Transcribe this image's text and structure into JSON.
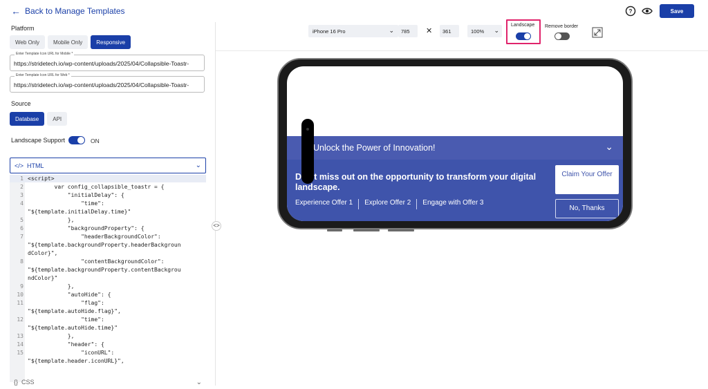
{
  "header": {
    "back_label": "Back to Manage Templates",
    "save_label": "Save"
  },
  "left": {
    "platform_label": "Platform",
    "platform_options": [
      "Web Only",
      "Mobile Only",
      "Responsive"
    ],
    "mobile_icon_legend": "Enter Template Icon URL for Mobile *",
    "mobile_icon_value": "https://stridetech.io/wp-content/uploads/2025/04/Collapsible-Toastr-",
    "web_icon_legend": "Enter Template Icon URL for Web *",
    "web_icon_value": "https://stridetech.io/wp-content/uploads/2025/04/Collapsible-Toastr-",
    "source_label": "Source",
    "source_options": [
      "Database",
      "API"
    ],
    "landscape_support_label": "Landscape Support",
    "landscape_support_state": "ON",
    "html_select_label": "HTML",
    "css_select_label": "CSS",
    "code_lines": [
      {
        "num": "1",
        "text": "<script>"
      },
      {
        "num": "2",
        "text": "        var config_collapsible_toastr = {"
      },
      {
        "num": "3",
        "text": "            \"initialDelay\": {"
      },
      {
        "num": "4",
        "text": "                \"time\":"
      },
      {
        "num": "",
        "text": "\"${template.initialDelay.time}\""
      },
      {
        "num": "5",
        "text": "            },"
      },
      {
        "num": "6",
        "text": "            \"backgroundProperty\": {"
      },
      {
        "num": "7",
        "text": "                \"headerBackgroundColor\":"
      },
      {
        "num": "",
        "text": "\"${template.backgroundProperty.headerBackgroun"
      },
      {
        "num": "",
        "text": "dColor}\","
      },
      {
        "num": "8",
        "text": "                \"contentBackgroundColor\":"
      },
      {
        "num": "",
        "text": "\"${template.backgroundProperty.contentBackgrou"
      },
      {
        "num": "",
        "text": "ndColor}\""
      },
      {
        "num": "9",
        "text": "            },"
      },
      {
        "num": "10",
        "text": "            \"autoHide\": {"
      },
      {
        "num": "11",
        "text": "                \"flag\":"
      },
      {
        "num": "",
        "text": "\"${template.autoHide.flag}\","
      },
      {
        "num": "12",
        "text": "                \"time\":"
      },
      {
        "num": "",
        "text": "\"${template.autoHide.time}\""
      },
      {
        "num": "13",
        "text": "            },"
      },
      {
        "num": "14",
        "text": "            \"header\": {"
      },
      {
        "num": "15",
        "text": "                \"iconURL\":"
      },
      {
        "num": "",
        "text": "\"${template.header.iconURL}\","
      }
    ]
  },
  "toolbar": {
    "device": "iPhone 16 Pro",
    "width": "785",
    "times": "✕",
    "height": "361",
    "zoom": "100%",
    "landscape_label": "Landscape",
    "remove_border_label": "Remove border"
  },
  "preview": {
    "header_title": "Unlock the Power of Innovation!",
    "message": "Don't miss out on the opportunity to transform your digital landscape.",
    "links": [
      "Experience Offer 1",
      "Explore Offer 2",
      "Engage with Offer 3"
    ],
    "claim_label": "Claim Your Offer",
    "no_thanks_label": "No, Thanks"
  },
  "colors": {
    "primary": "#1a3fa8",
    "highlight": "#e0236b",
    "toast_header": "#4a5bb0",
    "toast_body": "#3f54ab"
  }
}
